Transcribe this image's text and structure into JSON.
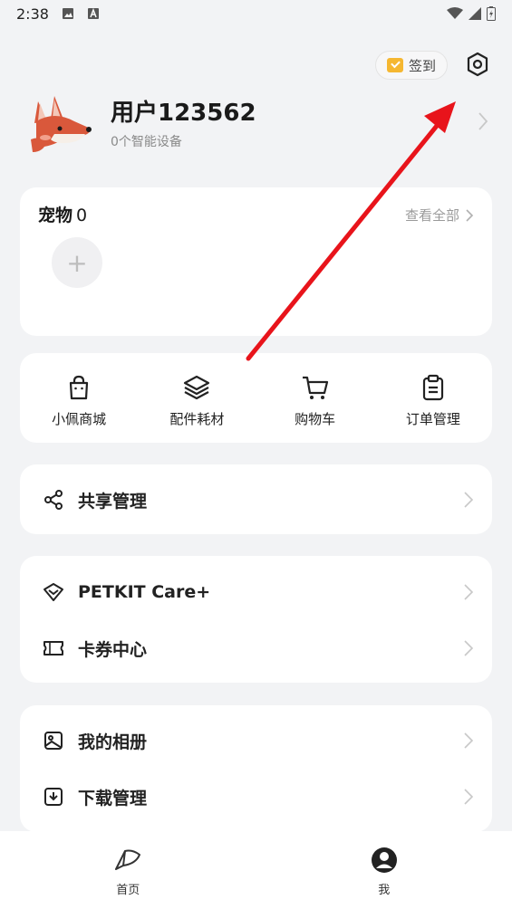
{
  "status_bar": {
    "time": "2:38"
  },
  "header": {
    "checkin_label": "签到"
  },
  "profile": {
    "username": "用户123562",
    "device_count": "0个智能设备"
  },
  "pets": {
    "title": "宠物",
    "count": "0",
    "view_all": "查看全部",
    "add_symbol": "+"
  },
  "shop": {
    "items": [
      {
        "label": "小佩商城",
        "icon": "shopping-bag-icon"
      },
      {
        "label": "配件耗材",
        "icon": "layers-icon"
      },
      {
        "label": "购物车",
        "icon": "cart-icon"
      },
      {
        "label": "订单管理",
        "icon": "clipboard-icon"
      }
    ]
  },
  "share": {
    "label": "共享管理"
  },
  "care": {
    "petkit_label": "PETKIT Care+",
    "coupons_label": "卡券中心"
  },
  "media": {
    "album_label": "我的相册",
    "downloads_label": "下载管理"
  },
  "bottom_nav": {
    "home_label": "首页",
    "me_label": "我"
  },
  "colors": {
    "accent_arrow": "#e8141b",
    "checkin_icon": "#f5b731",
    "background": "#f2f3f5"
  }
}
